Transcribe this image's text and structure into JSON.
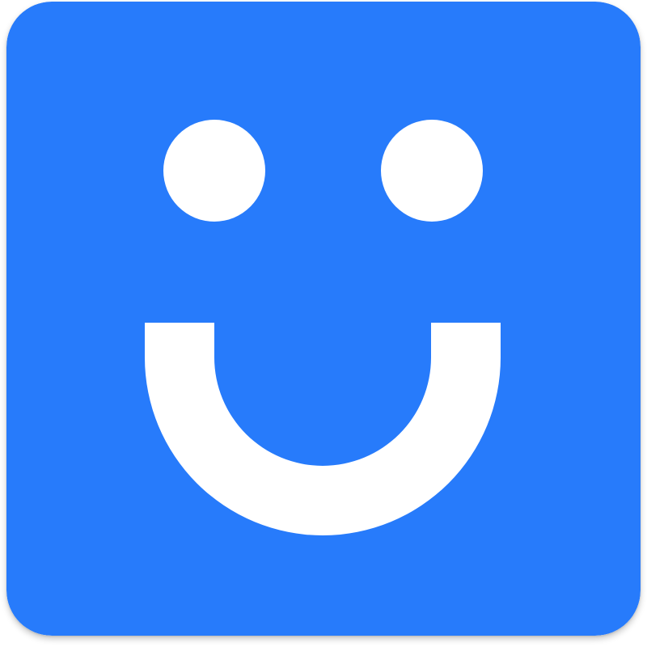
{
  "icon": {
    "name": "smiley-face-app-icon",
    "depicts": "smiley-face-icon",
    "background_color": "#277BFB",
    "foreground_color": "#FFFFFF"
  }
}
